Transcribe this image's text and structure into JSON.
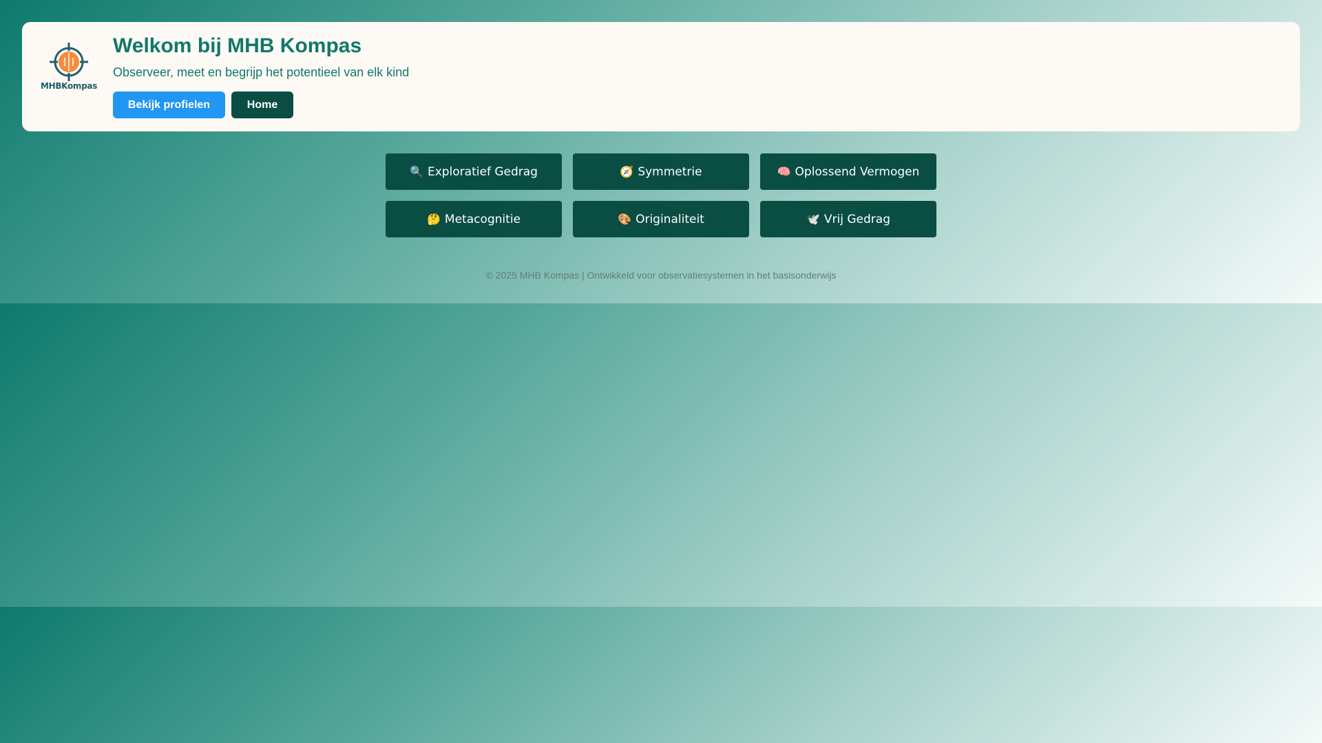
{
  "header": {
    "logo_text": "MHBKompas",
    "title": "Welkom bij MHB Kompas",
    "subtitle": "Observeer, meet en begrijp het potentieel van elk kind",
    "buttons": {
      "profiles_label": "Bekijk profielen",
      "home_label": "Home"
    }
  },
  "categories": [
    {
      "label": "Exploratief Gedrag",
      "icon": "magnifier-icon",
      "glyph": "🔍"
    },
    {
      "label": "Symmetrie",
      "icon": "compass-icon",
      "glyph": "🧭"
    },
    {
      "label": "Oplossend Vermogen",
      "icon": "brain-icon",
      "glyph": "🧠"
    },
    {
      "label": "Metacognitie",
      "icon": "thinking-face-icon",
      "glyph": "🤔"
    },
    {
      "label": "Originaliteit",
      "icon": "palette-icon",
      "glyph": "🎨"
    },
    {
      "label": "Vrij Gedrag",
      "icon": "dove-icon",
      "glyph": "🕊️"
    }
  ],
  "footer": {
    "text": "© 2025 MHB Kompas | Ontwikkeld voor observatiesystemen in het basisonderwijs"
  },
  "colors": {
    "brand_teal": "#117868",
    "dark_button": "#0a4d43",
    "primary_button": "#2196f3",
    "card_background": "#fdf9f5"
  }
}
